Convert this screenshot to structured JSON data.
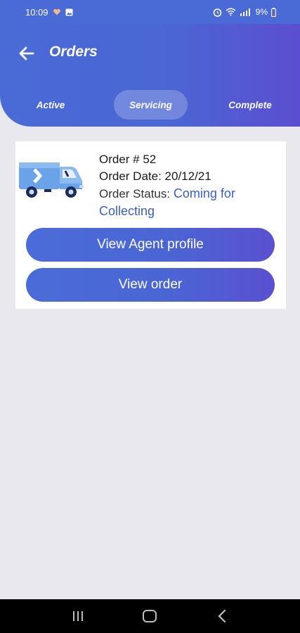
{
  "status_bar": {
    "time": "10:09",
    "battery": "9%",
    "icons": [
      "heart-notification-icon",
      "image-notification-icon",
      "alarm-icon",
      "wifi-icon",
      "signal-icon",
      "battery-icon"
    ]
  },
  "header": {
    "title": "Orders",
    "back_icon": "arrow-left-icon",
    "tabs": [
      {
        "label": "Active",
        "selected": false
      },
      {
        "label": "Servicing",
        "selected": true
      },
      {
        "label": "Complete",
        "selected": false
      }
    ]
  },
  "order": {
    "number_text": "Order # 52",
    "date_label": "Order Date:",
    "date_value": "20/12/21",
    "status_label": "Order Status:",
    "status_value": "Coming for Collecting",
    "icon": "delivery-truck-icon",
    "view_agent_label": "View Agent profile",
    "view_order_label": "View order"
  },
  "nav_bar": {
    "buttons": [
      "recent-apps-icon",
      "home-icon",
      "back-icon"
    ]
  },
  "colors": {
    "primary": "#4a6ad6",
    "accent_end": "#5a50d1",
    "status_text": "#3b5fc0",
    "background": "#e8e8ee"
  }
}
